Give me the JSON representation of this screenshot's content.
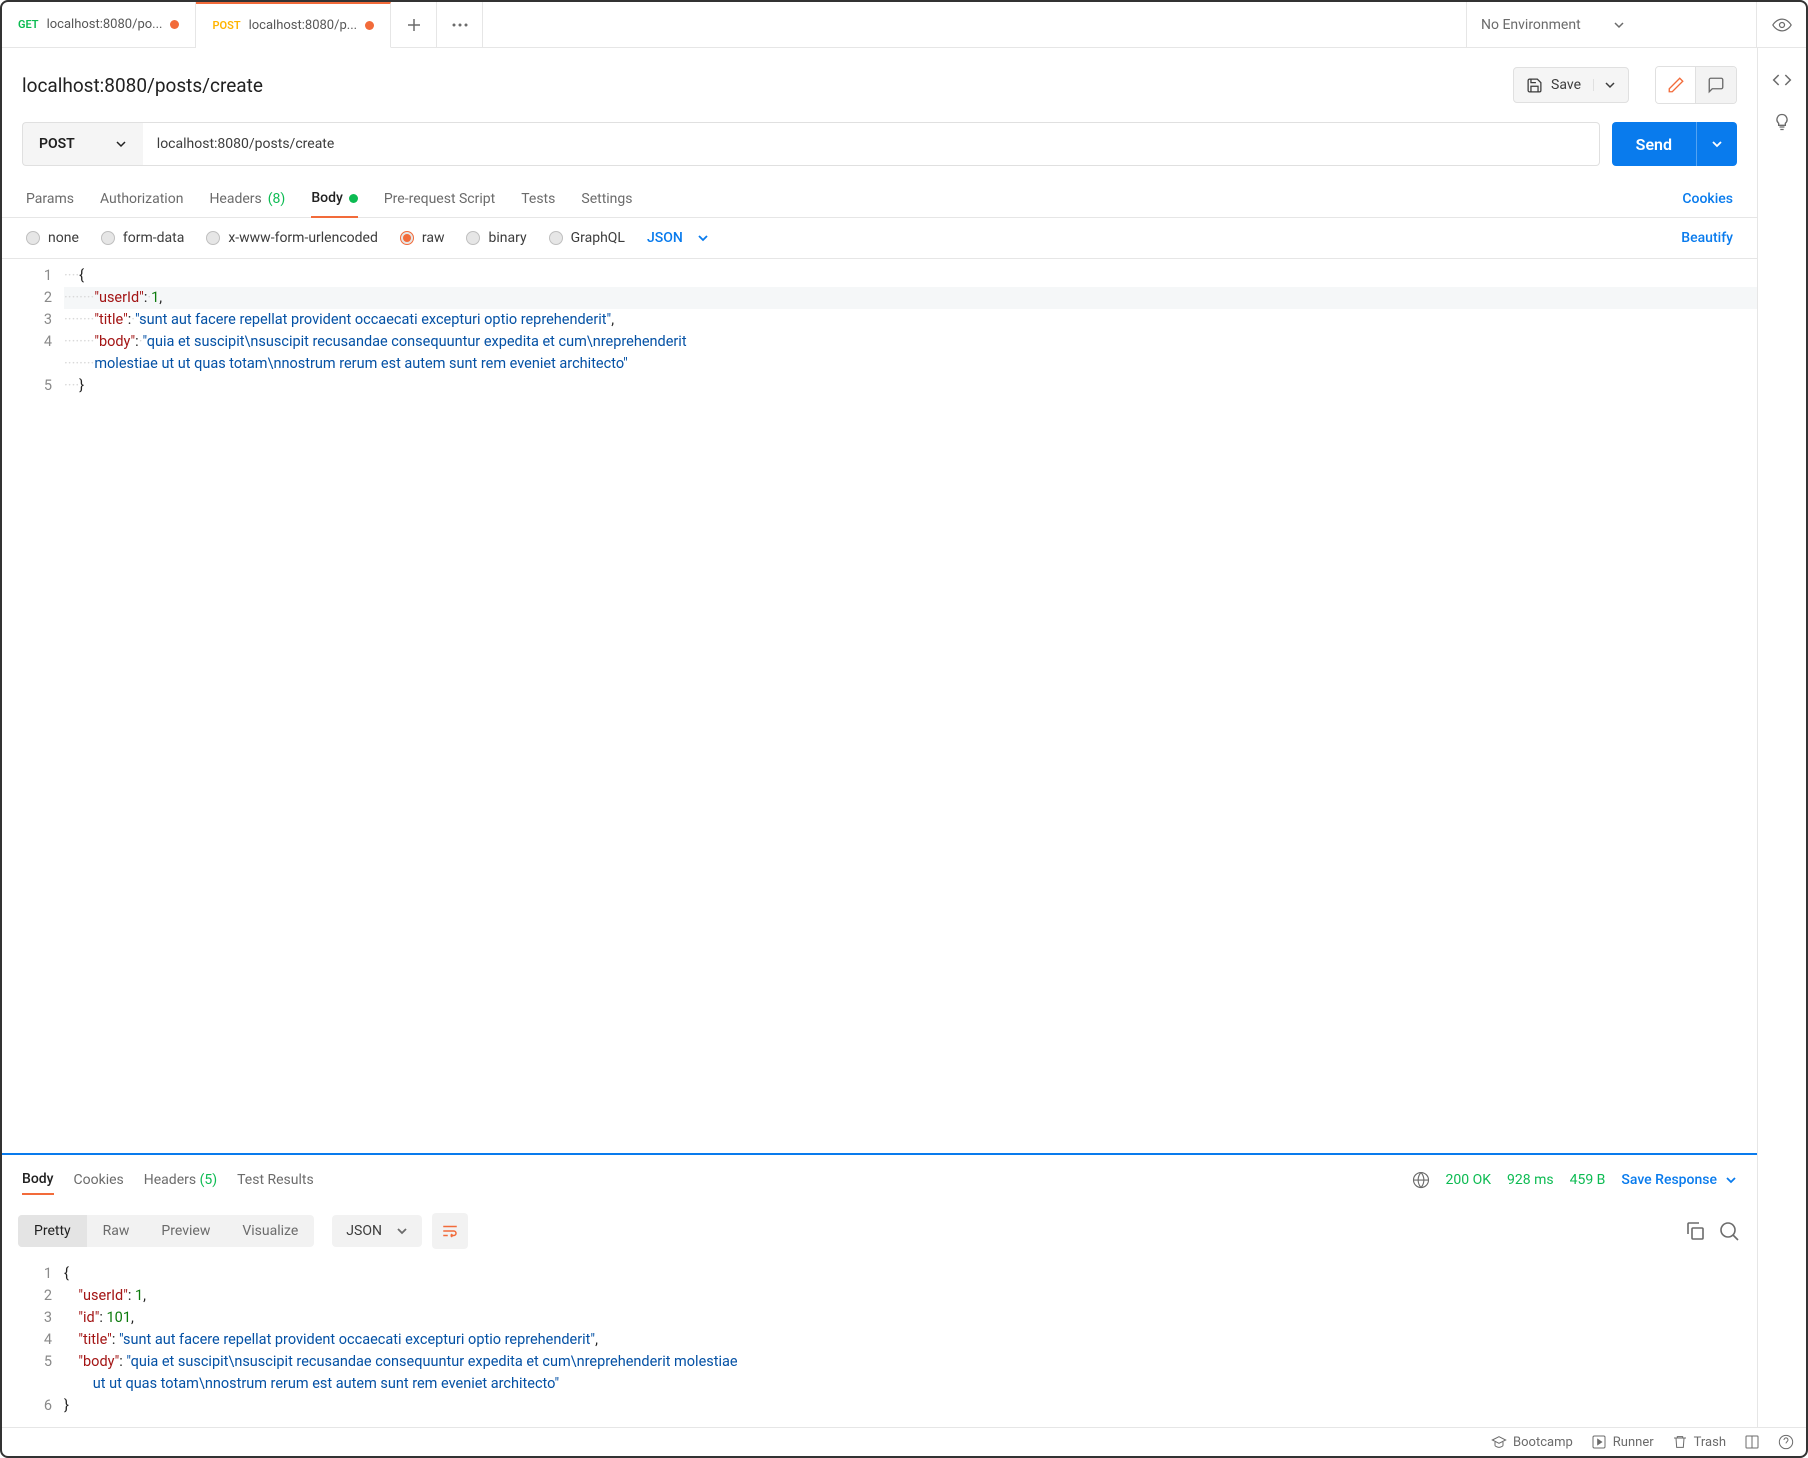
{
  "tabs": [
    {
      "method": "GET",
      "label": "localhost:8080/po...",
      "modified": true
    },
    {
      "method": "POST",
      "label": "localhost:8080/p...",
      "modified": true,
      "active": true
    }
  ],
  "environment": {
    "label": "No Environment"
  },
  "request": {
    "title": "localhost:8080/posts/create",
    "save_label": "Save",
    "method": "POST",
    "url": "localhost:8080/posts/create",
    "send_label": "Send"
  },
  "req_tabs": {
    "params": "Params",
    "auth": "Authorization",
    "headers": "Headers",
    "headers_count": "(8)",
    "body": "Body",
    "prerequest": "Pre-request Script",
    "tests": "Tests",
    "settings": "Settings",
    "cookies": "Cookies"
  },
  "body_types": {
    "none": "none",
    "formdata": "form-data",
    "urlencoded": "x-www-form-urlencoded",
    "raw": "raw",
    "binary": "binary",
    "graphql": "GraphQL",
    "lang": "JSON",
    "beautify": "Beautify"
  },
  "request_body": {
    "lines": [
      "1",
      "2",
      "3",
      "4",
      "",
      "5"
    ],
    "json": {
      "userId": 1,
      "title": "sunt aut facere repellat provident occaecati excepturi optio reprehenderit",
      "body": "quia et suscipit\\nsuscipit recusandae consequuntur expedita et cum\\nreprehenderit molestiae ut ut quas totam\\nnostrum rerum est autem sunt rem eveniet architecto"
    }
  },
  "response": {
    "tabs": {
      "body": "Body",
      "cookies": "Cookies",
      "headers": "Headers",
      "headers_count": "(5)",
      "tests": "Test Results"
    },
    "status": "200 OK",
    "time": "928 ms",
    "size": "459 B",
    "save": "Save Response",
    "views": {
      "pretty": "Pretty",
      "raw": "Raw",
      "preview": "Preview",
      "visualize": "Visualize"
    },
    "format": "JSON",
    "lines": [
      "1",
      "2",
      "3",
      "4",
      "5",
      "",
      "6"
    ],
    "json": {
      "userId": 1,
      "id": 101,
      "title": "sunt aut facere repellat provident occaecati excepturi optio reprehenderit",
      "body": "quia et suscipit\\nsuscipit recusandae consequuntur expedita et cum\\nreprehenderit molestiae ut ut quas totam\\nnostrum rerum est autem sunt rem eveniet architecto"
    }
  },
  "footer": {
    "bootcamp": "Bootcamp",
    "runner": "Runner",
    "trash": "Trash"
  }
}
